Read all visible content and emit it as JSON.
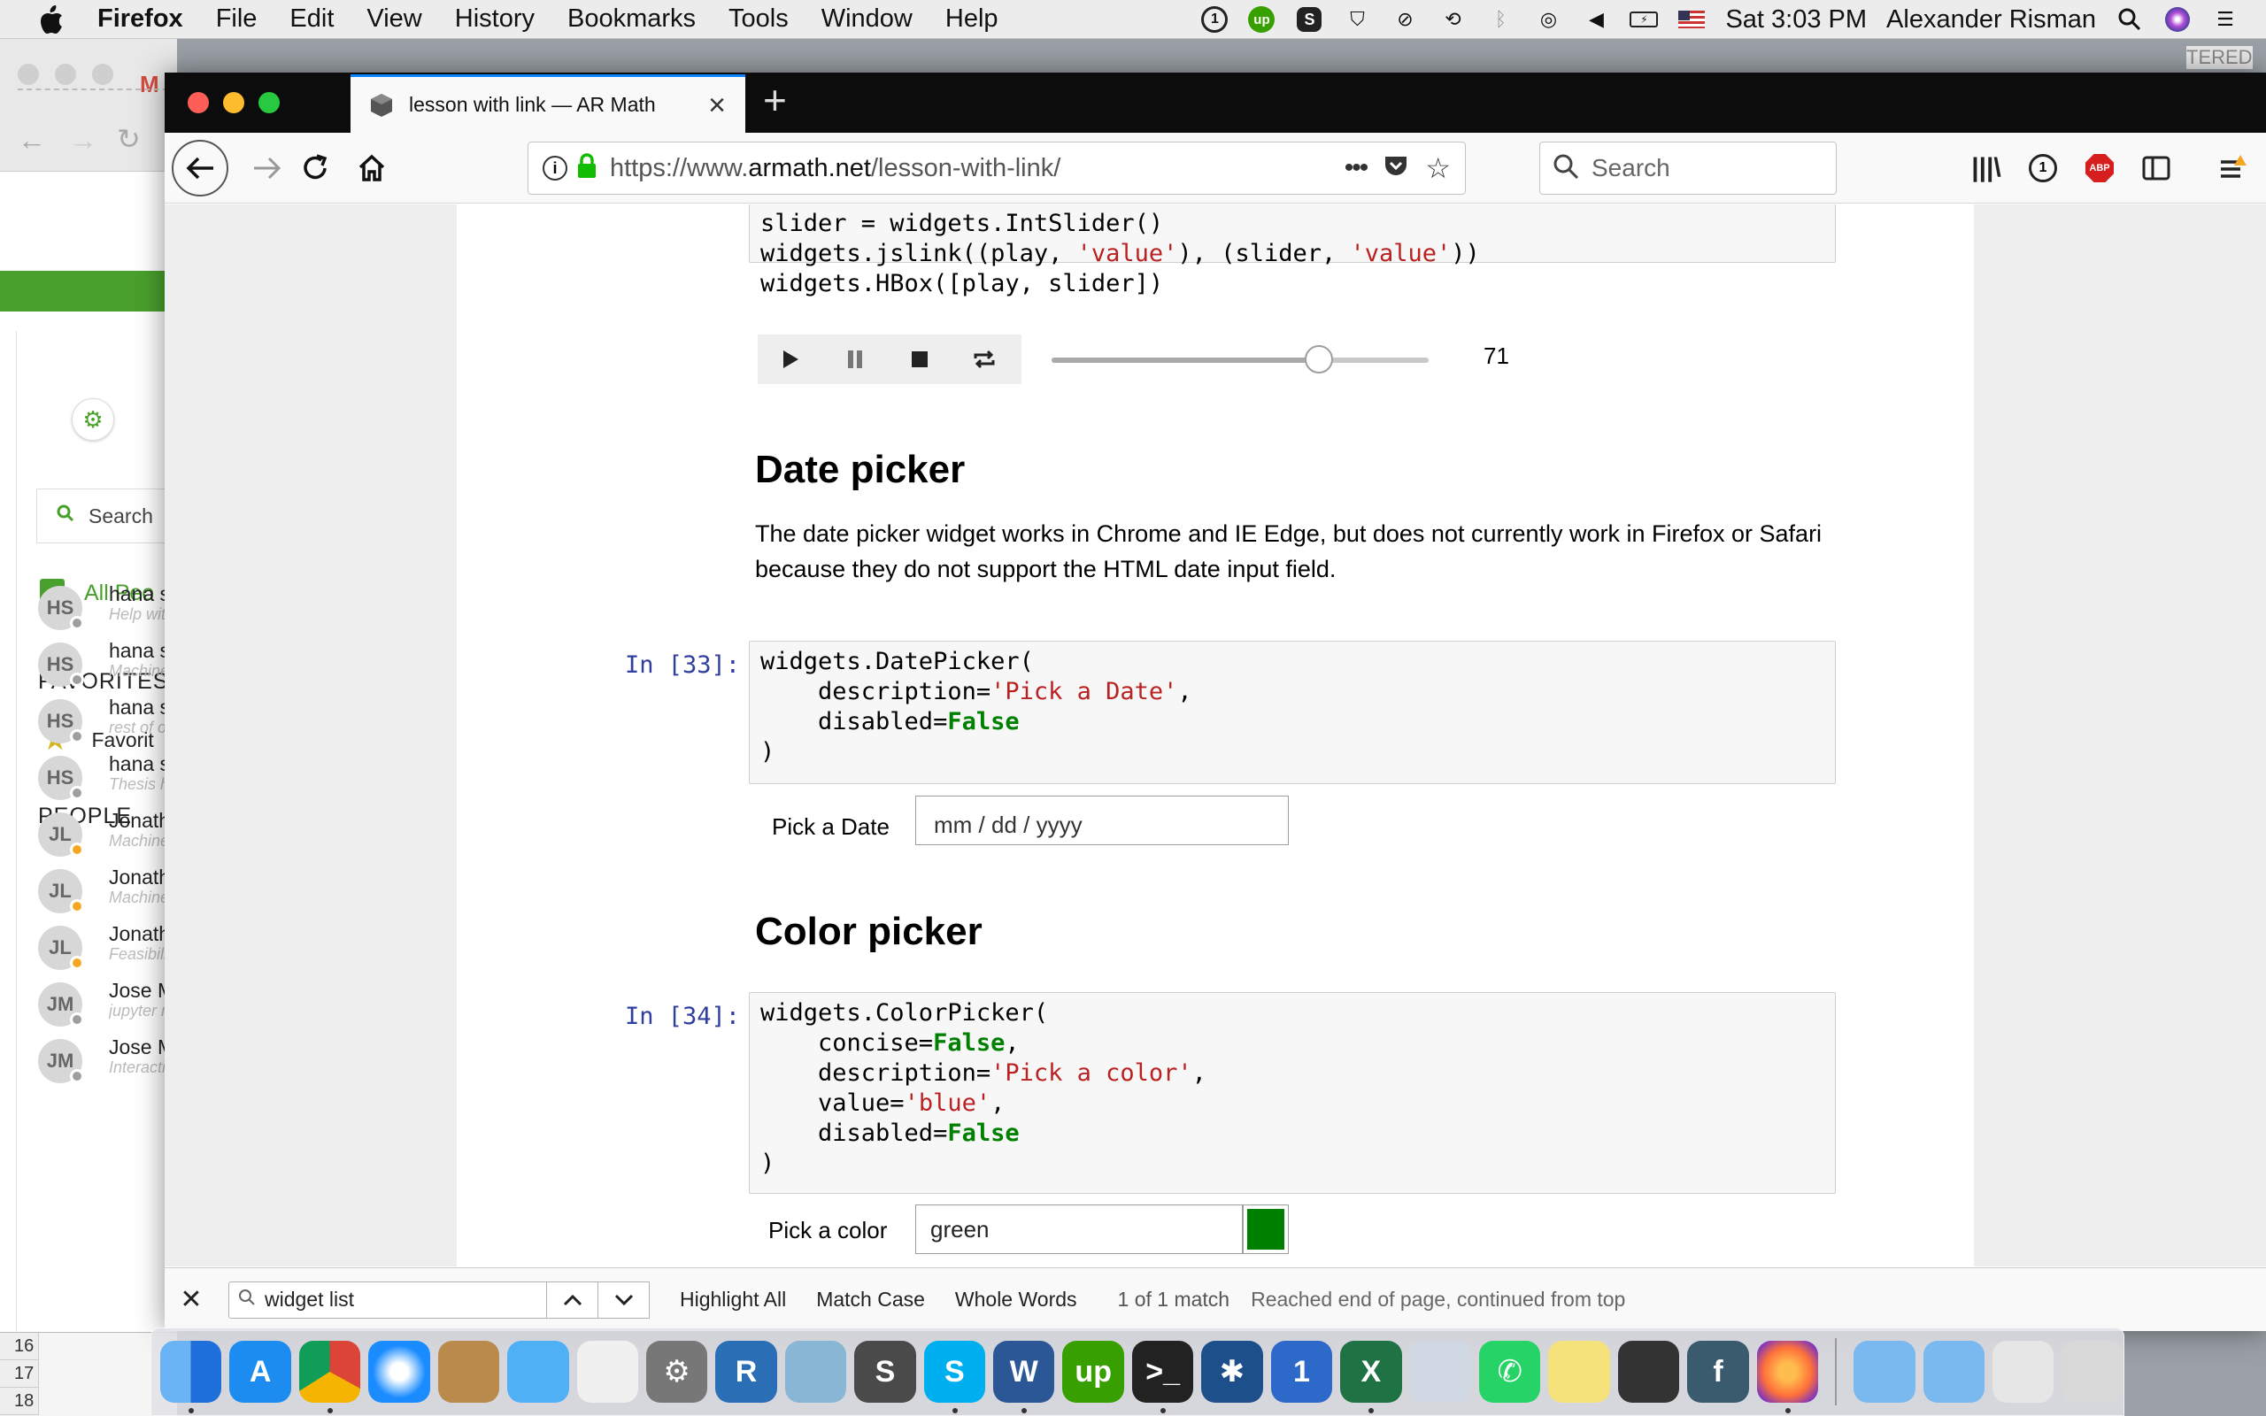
{
  "menubar": {
    "app": "Firefox",
    "items": [
      "File",
      "Edit",
      "View",
      "History",
      "Bookmarks",
      "Tools",
      "Window",
      "Help"
    ],
    "clock": "Sat 3:03 PM",
    "user": "Alexander Risman"
  },
  "bg_window": {
    "search_label": "Search",
    "all_people_label": "All Peo",
    "favorites_header": "FAVORITES",
    "favorite_item": "Favorit",
    "people_header": "PEOPLE",
    "corner_text": "TERED",
    "people": [
      {
        "initials": "HS",
        "name": "hana sa",
        "sub": "Help wit",
        "status": "gray"
      },
      {
        "initials": "HS",
        "name": "hana sa",
        "sub": "Machine",
        "status": "gray"
      },
      {
        "initials": "HS",
        "name": "hana sa",
        "sub": "rest of o",
        "status": "gray"
      },
      {
        "initials": "HS",
        "name": "hana sa",
        "sub": "Thesis h",
        "status": "gray"
      },
      {
        "initials": "JL",
        "name": "Jonatha",
        "sub": "Machine",
        "status": "orange"
      },
      {
        "initials": "JL",
        "name": "Jonatha",
        "sub": "Machine",
        "status": "orange"
      },
      {
        "initials": "JL",
        "name": "Jonatha",
        "sub": "Feasibili",
        "status": "orange"
      },
      {
        "initials": "JM",
        "name": "Jose Ma",
        "sub": "jupyter r",
        "status": "gray"
      },
      {
        "initials": "JM",
        "name": "Jose Ma",
        "sub": "Interacti",
        "status": "gray"
      }
    ],
    "excel_rows": [
      "16",
      "17",
      "18"
    ]
  },
  "tab": {
    "title": "lesson with link — AR Math"
  },
  "navbar": {
    "url_prefix": "https://www.",
    "url_domain": "armath.net",
    "url_path": "/lesson-with-link/",
    "search_placeholder": "Search"
  },
  "notebook": {
    "code_top": {
      "line1": "slider = widgets.IntSlider()",
      "line2_a": "widgets.jslink((play, ",
      "line2_s1": "'value'",
      "line2_b": "), (slider, ",
      "line2_s2": "'value'",
      "line2_c": "))",
      "line3": "widgets.HBox([play, slider])"
    },
    "slider_value": "71",
    "slider_fraction": 0.71,
    "date_heading": "Date picker",
    "date_para": "The date picker widget works in Chrome and IE Edge, but does not currently work in Firefox or Safari because they do not support the HTML date input field.",
    "cell33": {
      "prompt": "In [33]:",
      "l1": "widgets.DatePicker(",
      "l2_a": "    description=",
      "l2_s": "'Pick a Date'",
      "l2_b": ",",
      "l3_a": "    disabled=",
      "l3_k": "False",
      "l4": ")"
    },
    "date_label": "Pick a Date",
    "date_placeholder": "mm / dd / yyyy",
    "color_heading": "Color picker",
    "cell34": {
      "prompt": "In [34]:",
      "l1": "widgets.ColorPicker(",
      "l2_a": "    concise=",
      "l2_k": "False",
      "l2_b": ",",
      "l3_a": "    description=",
      "l3_s": "'Pick a color'",
      "l3_b": ",",
      "l4_a": "    value=",
      "l4_s": "'blue'",
      "l4_b": ",",
      "l5_a": "    disabled=",
      "l5_k": "False",
      "l6": ")"
    },
    "color_label": "Pick a color",
    "color_value": "green",
    "color_swatch": "#008000"
  },
  "findbar": {
    "query": "widget list",
    "highlight_all": "Highlight All",
    "match_case": "Match Case",
    "whole_words": "Whole Words",
    "status": "1 of 1 match",
    "message": "Reached end of page, continued from top"
  },
  "colors": {
    "accent": "#0a84ff",
    "keyword": "#008000",
    "string": "#ba2121",
    "prompt": "#303f9f",
    "green_bar": "#4aa02c"
  }
}
